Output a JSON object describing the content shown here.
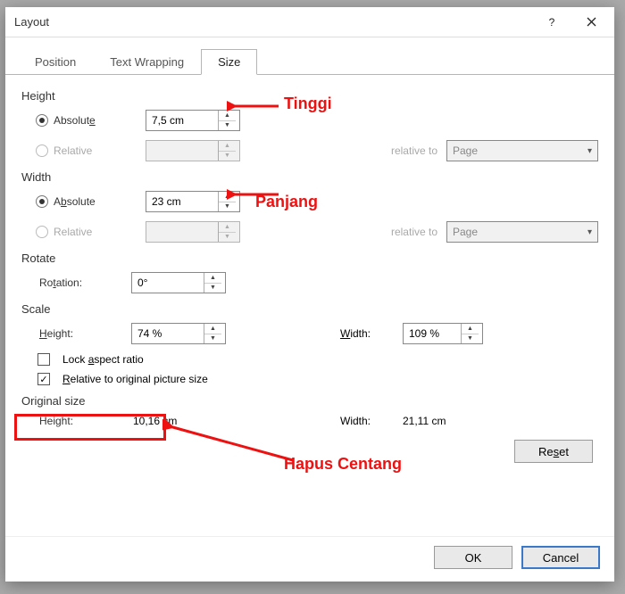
{
  "titlebar": {
    "title": "Layout"
  },
  "tabs": {
    "position": "Position",
    "text_wrapping": "Text Wrapping",
    "size": "Size"
  },
  "height_section": {
    "title": "Height",
    "absolute_label": "Absolute",
    "absolute_value": "7,5 cm",
    "relative_label": "Relative",
    "relative_value": "",
    "relative_to": "relative to",
    "page": "Page"
  },
  "width_section": {
    "title": "Width",
    "absolute_label": "Absolute",
    "absolute_value": "23 cm",
    "relative_label": "Relative",
    "relative_value": "",
    "relative_to": "relative to",
    "page": "Page"
  },
  "rotate_section": {
    "title": "Rotate",
    "rotation_label": "Rotation:",
    "rotation_value": "0°"
  },
  "scale_section": {
    "title": "Scale",
    "height_label": "Height:",
    "height_value": "74 %",
    "width_label": "Width:",
    "width_value": "109 %",
    "lock_label": "Lock aspect ratio",
    "relative_label": "Relative to original picture size"
  },
  "original_section": {
    "title": "Original size",
    "height_label": "Height:",
    "height_value": "10,16 cm",
    "width_label": "Width:",
    "width_value": "21,11 cm"
  },
  "buttons": {
    "reset": "Reset",
    "ok": "OK",
    "cancel": "Cancel"
  },
  "annotations": {
    "tinggi": "Tinggi",
    "panjang": "Panjang",
    "hapus": "Hapus Centang"
  }
}
